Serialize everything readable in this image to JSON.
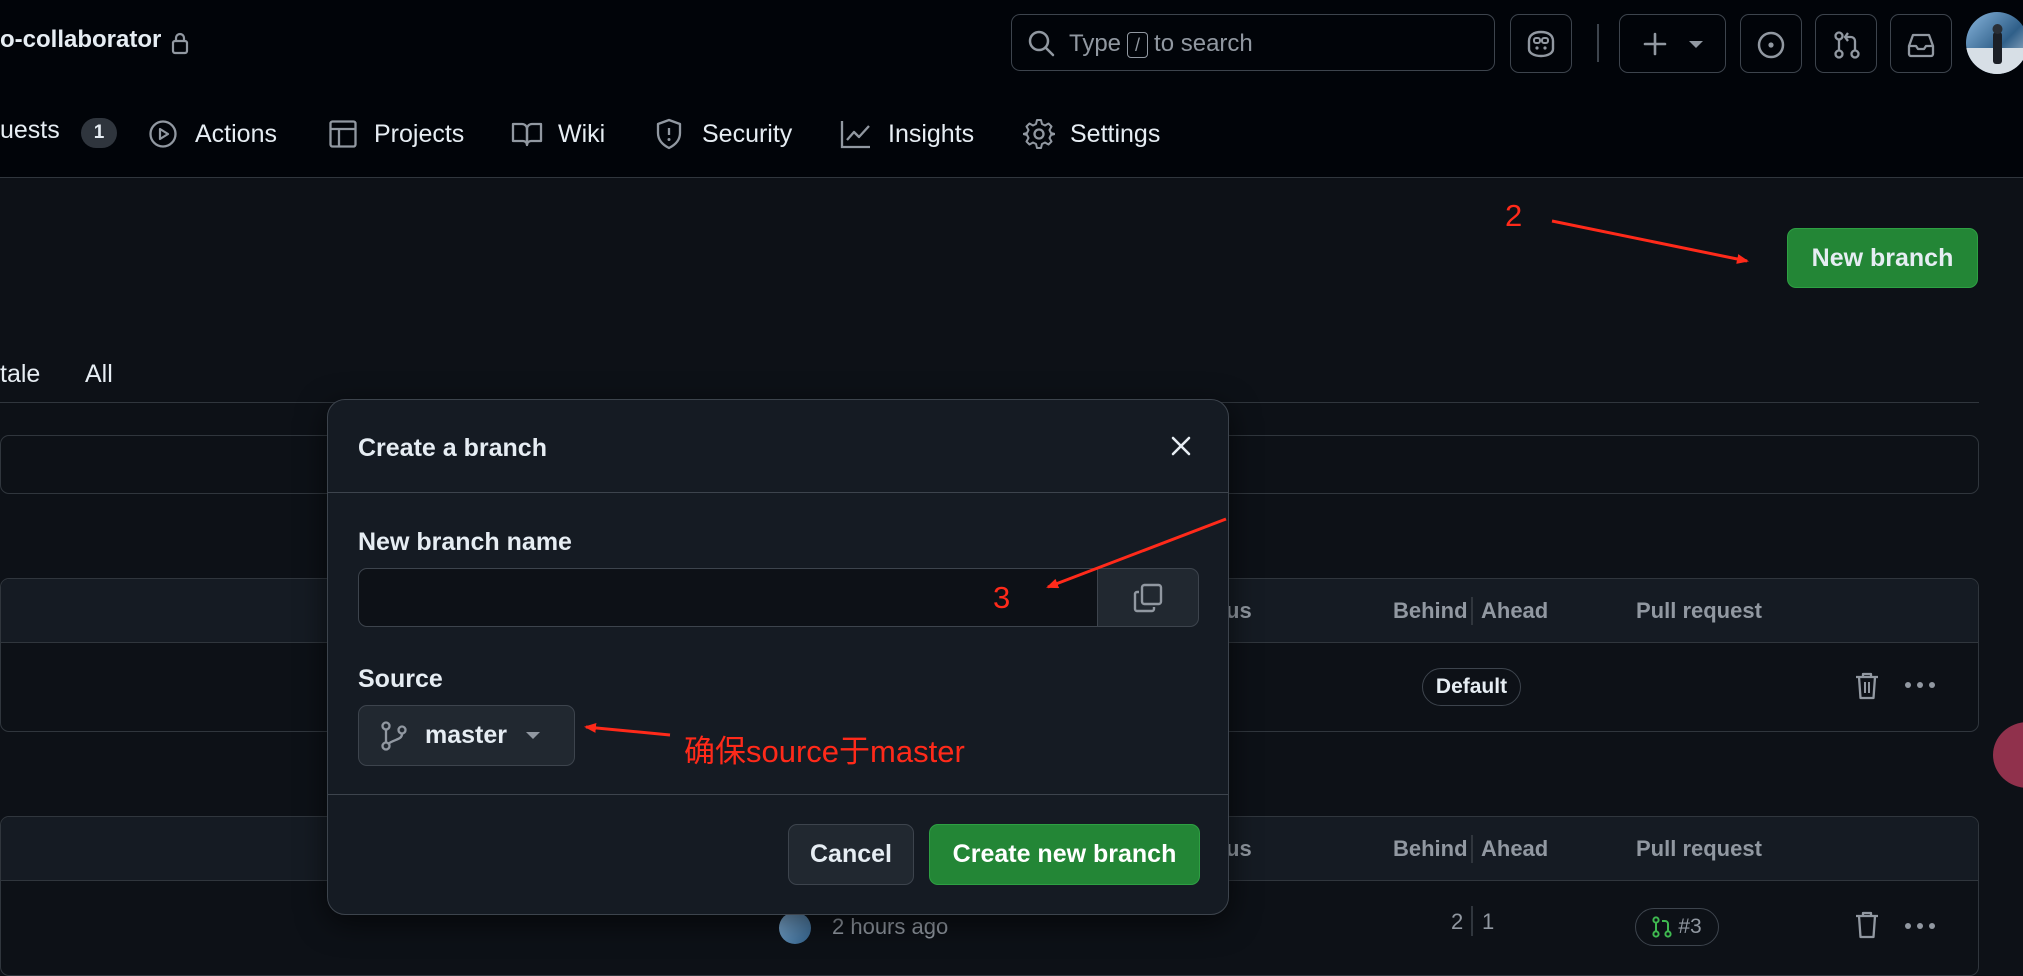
{
  "header": {
    "repo_name": "o-collaborator",
    "search": {
      "prefix": "Type",
      "key": "/",
      "suffix": "to search"
    },
    "tabs": [
      {
        "label": "uests",
        "count": "1"
      },
      {
        "label": "Actions"
      },
      {
        "label": "Projects"
      },
      {
        "label": "Wiki"
      },
      {
        "label": "Security"
      },
      {
        "label": "Insights"
      },
      {
        "label": "Settings"
      }
    ]
  },
  "page": {
    "new_branch_label": "New branch",
    "filters": [
      "tale",
      "All"
    ],
    "table_headers": {
      "status": "us",
      "behind": "Behind",
      "ahead": "Ahead",
      "pull_request": "Pull request"
    },
    "row1": {
      "default_badge": "Default"
    },
    "row2": {
      "updated": "2 hours ago",
      "behind": "2",
      "ahead": "1",
      "pr": "#3"
    }
  },
  "dialog": {
    "title": "Create a branch",
    "name_label": "New branch name",
    "name_value": "",
    "source_label": "Source",
    "source_value": "master",
    "cancel_label": "Cancel",
    "create_label": "Create new branch"
  },
  "annotations": {
    "step2": "2",
    "step3": "3",
    "source_note": "确保source于master"
  },
  "colors": {
    "accent_green": "#238636",
    "annotation_red": "#ff2a1a",
    "background": "#0d1117"
  }
}
